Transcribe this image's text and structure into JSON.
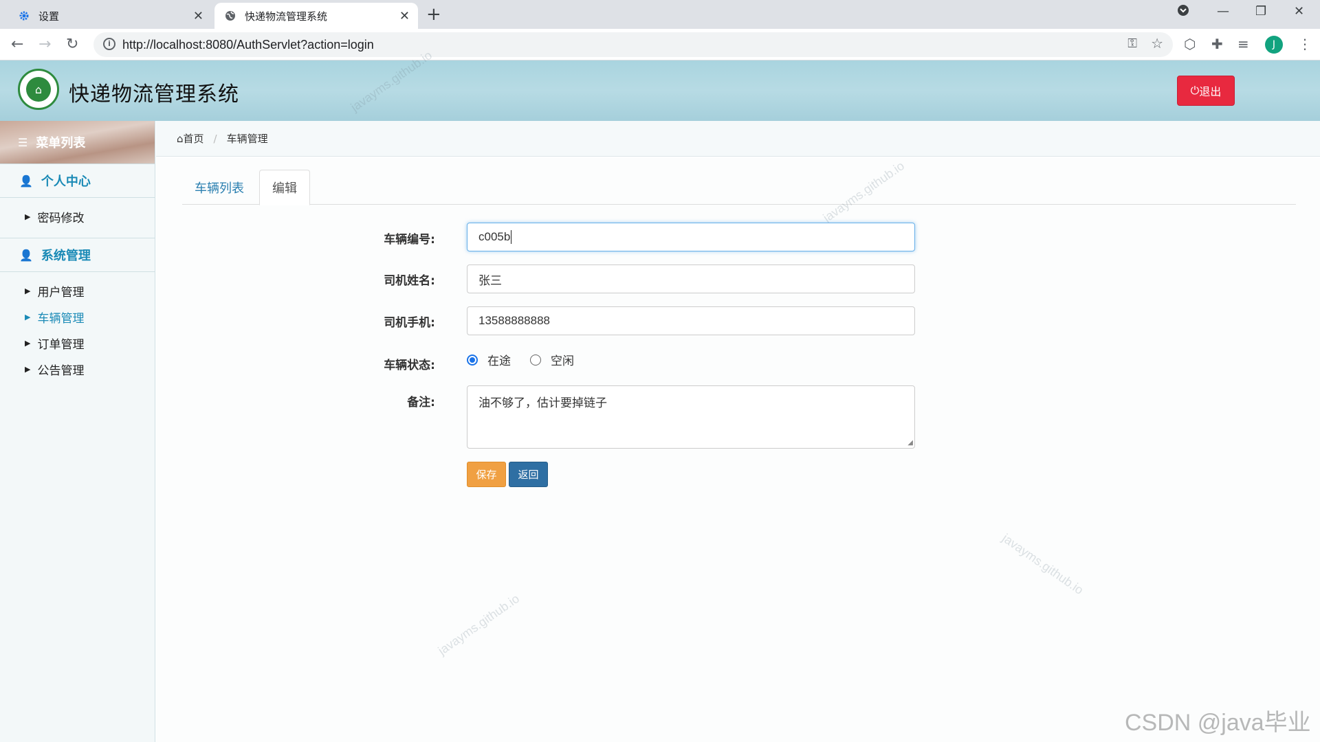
{
  "browser": {
    "tabs": [
      {
        "title": "设置",
        "icon": "gear-icon"
      },
      {
        "title": "快递物流管理系统",
        "icon": "globe-icon"
      }
    ],
    "url_host": "http://localhost",
    "url_rest": ":8080/AuthServlet?action=login",
    "profile_initial": "J"
  },
  "header": {
    "title": "快递物流管理系统",
    "logout_label": "退出"
  },
  "sidebar": {
    "menu_title": "菜单列表",
    "groups": [
      {
        "label": "个人中心",
        "items": [
          "密码修改"
        ]
      },
      {
        "label": "系统管理",
        "items": [
          "用户管理",
          "车辆管理",
          "订单管理",
          "公告管理"
        ]
      }
    ],
    "active_item": "车辆管理"
  },
  "breadcrumb": {
    "home": "首页",
    "current": "车辆管理"
  },
  "tabs": {
    "list": "车辆列表",
    "edit": "编辑"
  },
  "form": {
    "vehicle_no_label": "车辆编号:",
    "vehicle_no_value": "c005b",
    "driver_name_label": "司机姓名:",
    "driver_name_value": "张三",
    "driver_phone_label": "司机手机:",
    "driver_phone_value": "13588888888",
    "status_label": "车辆状态:",
    "status_options": [
      "在途",
      "空闲"
    ],
    "status_selected": "在途",
    "remark_label": "备注:",
    "remark_value": "油不够了，估计要掉链子",
    "save_label": "保存",
    "back_label": "返回"
  },
  "watermark_text": "javayms.github.io",
  "csdn_watermark": "CSDN @java毕业",
  "colors": {
    "accent": "#1a8ab6",
    "logout": "#e8293f",
    "save": "#f0a042",
    "back": "#2f6fa3"
  }
}
